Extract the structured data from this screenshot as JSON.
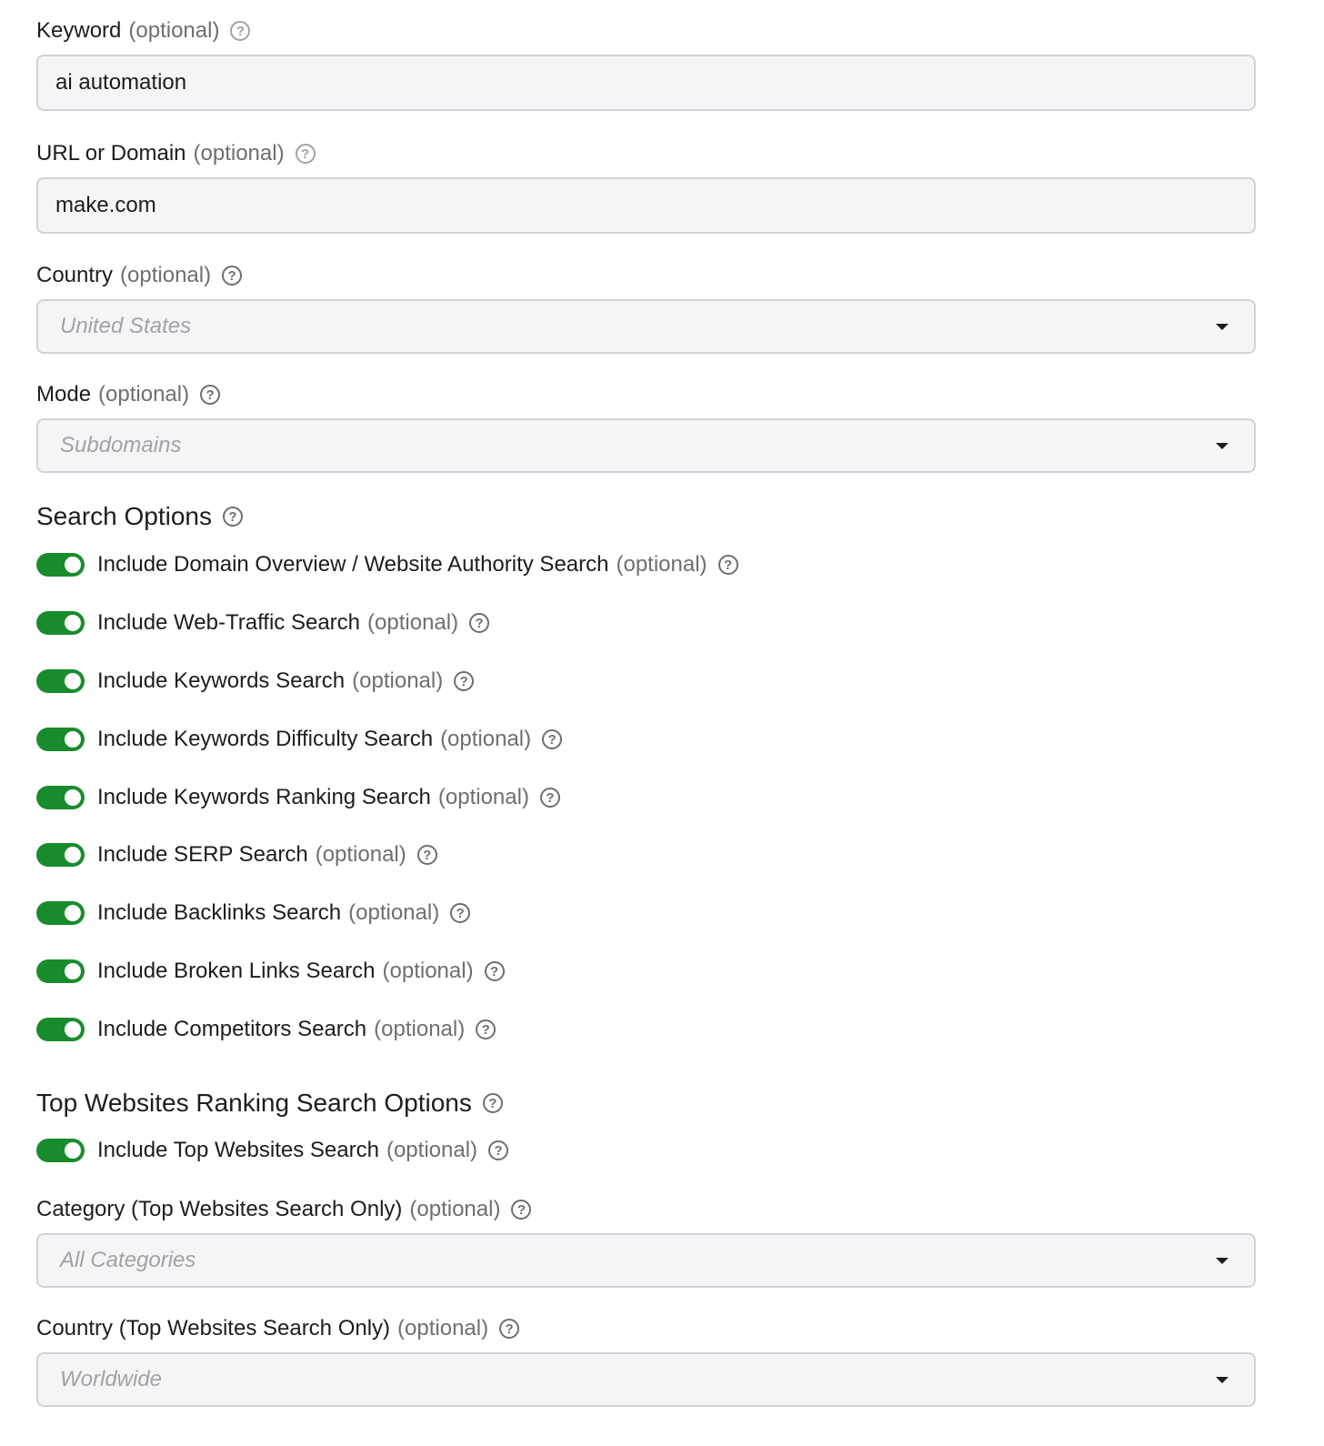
{
  "keyword": {
    "label": "Keyword",
    "optional": "(optional)",
    "value": "ai automation"
  },
  "url": {
    "label": "URL or Domain",
    "optional": "(optional)",
    "value": "make.com"
  },
  "country": {
    "label": "Country",
    "optional": "(optional)",
    "placeholder": "United States"
  },
  "mode": {
    "label": "Mode",
    "optional": "(optional)",
    "placeholder": "Subdomains"
  },
  "search_options": {
    "title": "Search Options",
    "items": [
      {
        "label": "Include Domain Overview / Website Authority Search",
        "optional": "(optional)",
        "on": true
      },
      {
        "label": "Include Web-Traffic Search",
        "optional": "(optional)",
        "on": true
      },
      {
        "label": "Include Keywords Search",
        "optional": "(optional)",
        "on": true
      },
      {
        "label": "Include Keywords Difficulty Search",
        "optional": "(optional)",
        "on": true
      },
      {
        "label": "Include Keywords Ranking Search",
        "optional": "(optional)",
        "on": true
      },
      {
        "label": "Include SERP Search",
        "optional": "(optional)",
        "on": true
      },
      {
        "label": "Include Backlinks Search",
        "optional": "(optional)",
        "on": true
      },
      {
        "label": "Include Broken Links Search",
        "optional": "(optional)",
        "on": true
      },
      {
        "label": "Include Competitors Search",
        "optional": "(optional)",
        "on": true
      }
    ]
  },
  "top_websites": {
    "title": "Top Websites Ranking Search Options",
    "toggle": {
      "label": "Include Top Websites Search",
      "optional": "(optional)",
      "on": true
    },
    "category": {
      "label": "Category (Top Websites Search Only)",
      "optional": "(optional)",
      "placeholder": "All Categories"
    },
    "country": {
      "label": "Country (Top Websites Search Only)",
      "optional": "(optional)",
      "placeholder": "Worldwide"
    }
  },
  "colors": {
    "toggle_on": "#188c2c",
    "field_bg": "#f5f5f7",
    "field_border": "#d2d2d7"
  },
  "icons": {
    "help": "?"
  }
}
